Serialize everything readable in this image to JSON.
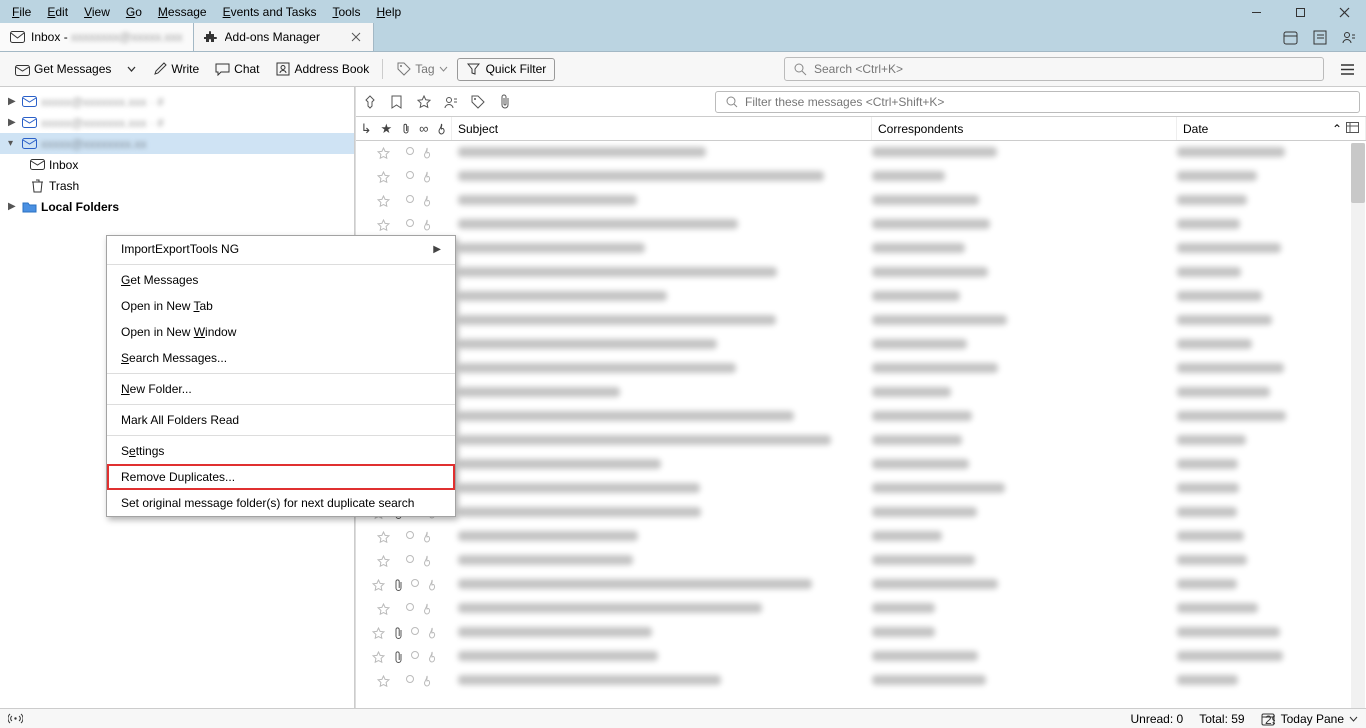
{
  "menubar": [
    "File",
    "Edit",
    "View",
    "Go",
    "Message",
    "Events and Tasks",
    "Tools",
    "Help"
  ],
  "tabs": {
    "inbox_prefix": "Inbox - ",
    "addons": "Add-ons Manager"
  },
  "toolbar": {
    "get_messages": "Get Messages",
    "write": "Write",
    "chat": "Chat",
    "address_book": "Address Book",
    "tag": "Tag",
    "quick_filter": "Quick Filter",
    "search_placeholder": "Search <Ctrl+K>"
  },
  "folders": {
    "inbox": "Inbox",
    "trash": "Trash",
    "local": "Local Folders"
  },
  "context_menu": {
    "items": [
      {
        "label": "ImportExportTools NG",
        "has_submenu": true
      },
      {
        "sep": true
      },
      {
        "label": "Get Messages",
        "ul": 0
      },
      {
        "label": "Open in New Tab",
        "ul": 12
      },
      {
        "label": "Open in New Window",
        "ul": 12
      },
      {
        "label": "Search Messages...",
        "ul": 0
      },
      {
        "sep": true
      },
      {
        "label": "New Folder...",
        "ul": 0
      },
      {
        "sep": true
      },
      {
        "label": "Mark All Folders Read"
      },
      {
        "sep": true
      },
      {
        "label": "Settings",
        "ul": 1
      },
      {
        "label": "Remove Duplicates...",
        "highlighted": true
      },
      {
        "label": "Set original message folder(s) for next duplicate search"
      }
    ]
  },
  "filterbar": {
    "placeholder": "Filter these messages <Ctrl+Shift+K>"
  },
  "columns": {
    "subject": "Subject",
    "correspondents": "Correspondents",
    "date": "Date"
  },
  "message_rows": 23,
  "attachment_rows": [
    14,
    15,
    18,
    20,
    21
  ],
  "status": {
    "unread_label": "Unread:",
    "unread_count": "0",
    "total_label": "Total:",
    "total_count": "59",
    "today_pane": "Today Pane"
  }
}
